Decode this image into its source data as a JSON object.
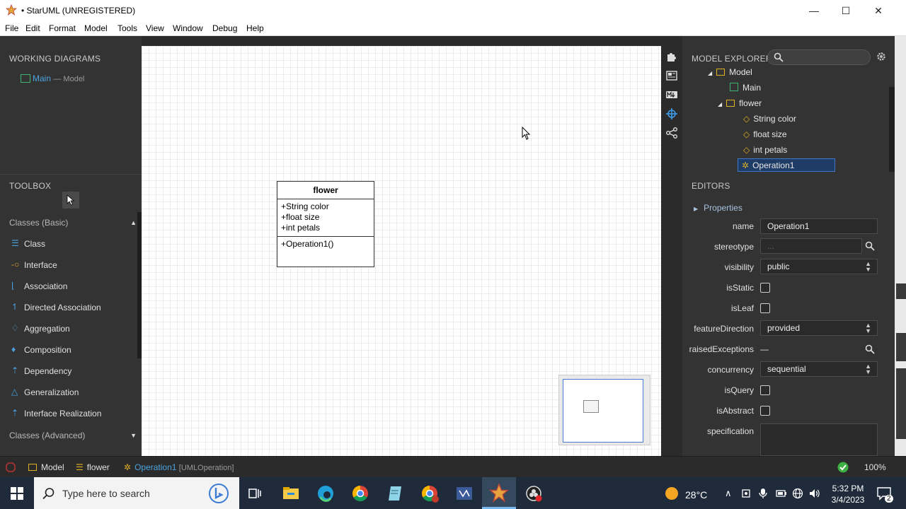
{
  "window": {
    "title": "• StarUML (UNREGISTERED)",
    "minimize": "—",
    "maximize": "☐",
    "close": "✕"
  },
  "menu": [
    "File",
    "Edit",
    "Format",
    "Model",
    "Tools",
    "View",
    "Window",
    "Debug",
    "Help"
  ],
  "working_diagrams": {
    "header": "WORKING DIAGRAMS",
    "item_name": "Main",
    "item_sub": "— Model"
  },
  "toolbox": {
    "header": "TOOLBOX",
    "group_basic": "Classes (Basic)",
    "items": [
      {
        "label": "Class",
        "icon": "class-icon"
      },
      {
        "label": "Interface",
        "icon": "interface-icon"
      },
      {
        "label": "Association",
        "icon": "association-icon"
      },
      {
        "label": "Directed Association",
        "icon": "directed-association-icon"
      },
      {
        "label": "Aggregation",
        "icon": "aggregation-icon"
      },
      {
        "label": "Composition",
        "icon": "composition-icon"
      },
      {
        "label": "Dependency",
        "icon": "dependency-icon"
      },
      {
        "label": "Generalization",
        "icon": "generalization-icon"
      },
      {
        "label": "Interface Realization",
        "icon": "interface-realization-icon"
      }
    ],
    "group_advanced": "Classes (Advanced)"
  },
  "diagram": {
    "class_name": "flower",
    "attributes": [
      "+String color",
      "+float size",
      "+int petals"
    ],
    "operations": [
      "+Operation1()"
    ]
  },
  "model_explorer": {
    "header": "MODEL EXPLORER",
    "search_placeholder": "",
    "tree": {
      "model": "Model",
      "main": "Main",
      "flower": "flower",
      "attr1": "String color",
      "attr2": "float size",
      "attr3": "int petals",
      "op1": "Operation1"
    }
  },
  "editors": {
    "header": "EDITORS",
    "properties_toggle": "Properties",
    "name_label": "name",
    "name_value": "Operation1",
    "stereotype_label": "stereotype",
    "stereotype_value": "...",
    "visibility_label": "visibility",
    "visibility_value": "public",
    "isStatic_label": "isStatic",
    "isLeaf_label": "isLeaf",
    "featureDirection_label": "featureDirection",
    "featureDirection_value": "provided",
    "raisedExceptions_label": "raisedExceptions",
    "raisedExceptions_value": "—",
    "concurrency_label": "concurrency",
    "concurrency_value": "sequential",
    "isQuery_label": "isQuery",
    "isAbstract_label": "isAbstract",
    "specification_label": "specification"
  },
  "statusbar": {
    "crumb1": "Model",
    "crumb2": "flower",
    "crumb3": "Operation1",
    "crumb3_type": "[UMLOperation]",
    "zoom": "100%"
  },
  "taskbar": {
    "search_placeholder": "Type here to search",
    "weather": "28°C",
    "time": "5:32 PM",
    "date": "3/4/2023",
    "notifications": "2"
  },
  "colors": {
    "accent": "#4aa3df",
    "panel": "#333333",
    "selection": "#1f3c66"
  }
}
